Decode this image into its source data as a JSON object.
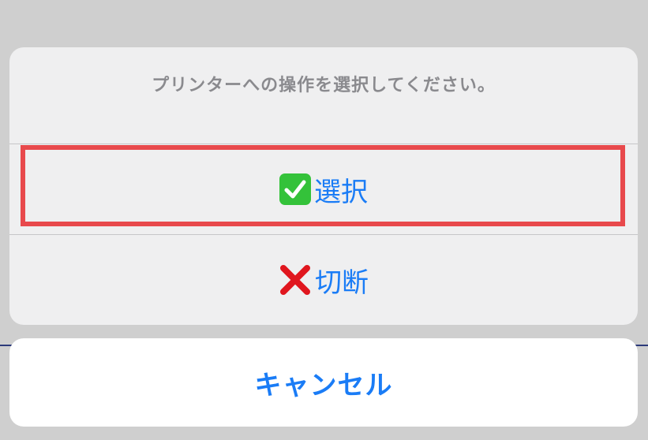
{
  "sheet": {
    "title": "プリンターへの操作を選択してください。",
    "actions": [
      {
        "icon": "check-mark-button-icon",
        "label": "選択"
      },
      {
        "icon": "cross-mark-icon",
        "label": "切断"
      }
    ],
    "cancel_label": "キャンセル"
  },
  "colors": {
    "action_text": "#1a7cf6",
    "highlight_border": "#e8494c",
    "check_green": "#34c23a",
    "cross_red": "#e0161e"
  }
}
